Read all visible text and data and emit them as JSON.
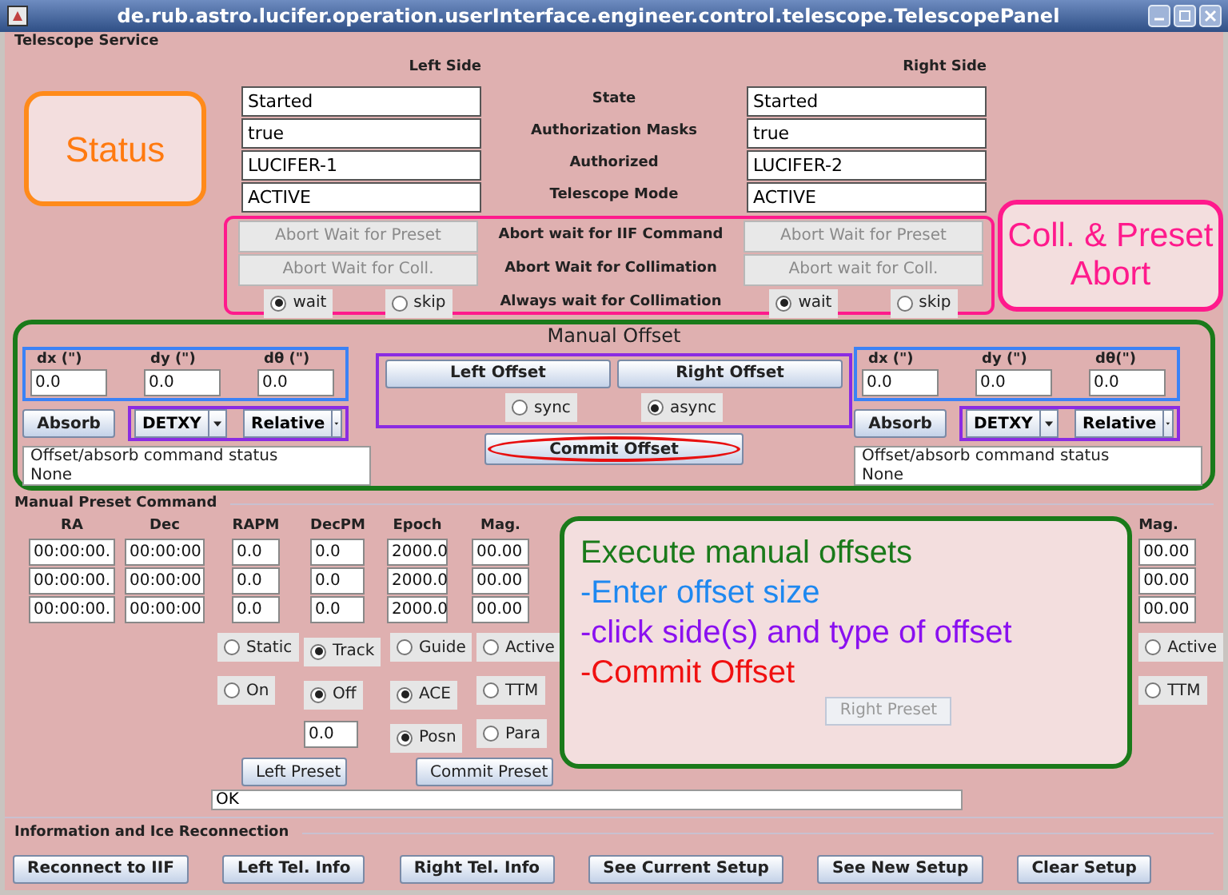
{
  "window": {
    "title": "de.rub.astro.lucifer.operation.userInterface.engineer.control.telescope.TelescopePanel"
  },
  "telescope_service": {
    "title": "Telescope Service",
    "left_header": "Left Side",
    "right_header": "Right Side",
    "rows": [
      {
        "label": "State",
        "left": "Started",
        "right": "Started"
      },
      {
        "label": "Authorization Masks",
        "left": "true",
        "right": "true"
      },
      {
        "label": "Authorized",
        "left": "LUCIFER-1",
        "right": "LUCIFER-2"
      },
      {
        "label": "Telescope Mode",
        "left": "ACTIVE",
        "right": "ACTIVE"
      }
    ],
    "abort_rows": [
      {
        "label": "Abort wait for IIF Command",
        "left": "Abort Wait for Preset",
        "right": "Abort Wait for Preset",
        "disabled": true
      },
      {
        "label": "Abort Wait for Collimation",
        "left": "Abort Wait for Coll.",
        "right": "Abort wait for Coll.",
        "disabled": true
      }
    ],
    "collimation": {
      "label": "Always wait for Collimation",
      "left": [
        {
          "label": "wait",
          "selected": true
        },
        {
          "label": "skip",
          "selected": false
        }
      ],
      "right": [
        {
          "label": "wait",
          "selected": true
        },
        {
          "label": "skip",
          "selected": false
        }
      ]
    }
  },
  "status_note": {
    "text": "Status"
  },
  "abort_note": {
    "lines": [
      "Coll. & Preset",
      "Abort"
    ]
  },
  "manual_offset": {
    "title": "Manual Offset",
    "sides": [
      {
        "fields": [
          {
            "label": "dx (\")",
            "value": "0.0"
          },
          {
            "label": "dy (\")",
            "value": "0.0"
          },
          {
            "label": "dθ (\")",
            "value": "0.0"
          }
        ],
        "absorb": "Absorb",
        "frame": "DETXY",
        "mode": "Relative",
        "status_title": "Offset/absorb command status",
        "status": "None"
      },
      {
        "fields": [
          {
            "label": "dx (\")",
            "value": "0.0"
          },
          {
            "label": "dy (\")",
            "value": "0.0"
          },
          {
            "label": "dθ(\")",
            "value": "0.0"
          }
        ],
        "absorb": "Absorb",
        "frame": "DETXY",
        "mode": "Relative",
        "status_title": "Offset/absorb command status",
        "status": "None"
      }
    ],
    "buttons": [
      "Left Offset",
      "Right Offset"
    ],
    "sync": [
      {
        "label": "sync",
        "selected": false
      },
      {
        "label": "async",
        "selected": true
      }
    ],
    "commit": "Commit Offset"
  },
  "manual_preset": {
    "title": "Manual Preset Command",
    "columns": [
      "RA",
      "Dec",
      "RAPM",
      "DecPM",
      "Epoch",
      "Mag."
    ],
    "rows": [
      [
        "00:00:00.",
        "00:00:00",
        "0.0",
        "0.0",
        "2000.0",
        "00.00"
      ],
      [
        "00:00:00.",
        "00:00:00",
        "0.0",
        "0.0",
        "2000.0",
        "00.00"
      ],
      [
        "00:00:00.",
        "00:00:00",
        "0.0",
        "0.0",
        "2000.0",
        "00.00"
      ]
    ],
    "mode": [
      {
        "label": "Static",
        "selected": false
      },
      {
        "label": "Track",
        "selected": true
      },
      {
        "label": "Guide",
        "selected": false
      },
      {
        "label": "Active",
        "selected": false
      }
    ],
    "ao": [
      {
        "label": "On",
        "selected": false
      },
      {
        "label": "Off",
        "selected": true
      },
      {
        "label": "ACE",
        "selected": true
      },
      {
        "label": "TTM",
        "selected": false
      }
    ],
    "rotator": {
      "value": "0.0",
      "options": [
        {
          "label": "Posn",
          "selected": true
        },
        {
          "label": "Para",
          "selected": false
        }
      ]
    },
    "left_button": "Left Preset",
    "commit_button": "Commit Preset",
    "right_button": "Right Preset",
    "message": "OK",
    "right_mag": {
      "header": "Mag.",
      "values": [
        "00.00",
        "00.00",
        "00.00"
      ],
      "mode": {
        "label": "Active",
        "selected": false
      },
      "ao": {
        "label": "TTM",
        "selected": false
      }
    }
  },
  "offset_note": {
    "lines": [
      {
        "text": "Execute manual offsets",
        "color": "#1a7a1a"
      },
      {
        "text": "-Enter offset size",
        "color": "#1e88f0"
      },
      {
        "text": "-click side(s) and type of offset",
        "color": "#8a10f0"
      },
      {
        "text": "-Commit Offset",
        "color": "#f01010"
      }
    ]
  },
  "info": {
    "title": "Information and Ice Reconnection",
    "buttons": [
      "Reconnect to IIF",
      "Left Tel. Info",
      "Right Tel. Info",
      "See Current Setup",
      "See New Setup",
      "Clear Setup"
    ]
  }
}
